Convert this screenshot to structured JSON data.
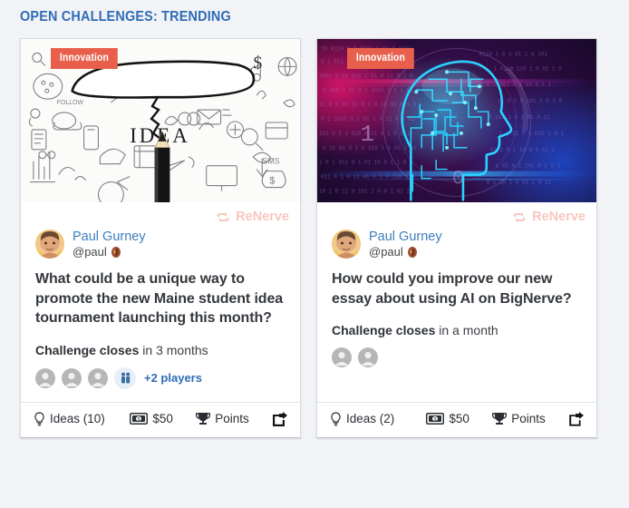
{
  "section": {
    "title": "OPEN CHALLENGES: TRENDING"
  },
  "colors": {
    "accent_blue": "#2f6cb5",
    "tag_red": "#e8604c",
    "renerve_pink": "#f7c7bf",
    "page_bg": "#f1f3f7",
    "card_bg": "#ffffff",
    "text_dark": "#34383d"
  },
  "cards": [
    {
      "tag": "Innovation",
      "hero_icon": "idea-doodle-pencil-image",
      "renerve_label": "ReNerve",
      "renerve_icon": "renerve-retweet-icon",
      "author": {
        "avatar_icon": "user-photo-avatar",
        "name": "Paul Gurney",
        "handle": "@paul",
        "badge_icon": "brain-emoji"
      },
      "title": "What could be a unique way to promote the new Maine student idea tournament launching this month?",
      "closes_label": "Challenge closes",
      "closes_value": "in 3 months",
      "player_avatars": 3,
      "more_players_icon": "two-people-icon",
      "more_players_label": "+2 players",
      "footer": {
        "ideas_icon": "lightbulb-icon",
        "ideas_label": "Ideas (10)",
        "money_icon": "money-bill-icon",
        "money_label": "$50",
        "points_icon": "trophy-icon",
        "points_label": "Points",
        "share_icon": "share-square-icon"
      }
    },
    {
      "tag": "Innovation",
      "hero_icon": "ai-brain-head-image",
      "renerve_label": "ReNerve",
      "renerve_icon": "renerve-retweet-icon",
      "author": {
        "avatar_icon": "user-photo-avatar",
        "name": "Paul Gurney",
        "handle": "@paul",
        "badge_icon": "brain-emoji"
      },
      "title": "How could you improve our new essay about using AI on BigNerve?",
      "closes_label": "Challenge closes",
      "closes_value": "in a month",
      "player_avatars": 2,
      "more_players_icon": null,
      "more_players_label": null,
      "footer": {
        "ideas_icon": "lightbulb-icon",
        "ideas_label": "Ideas (2)",
        "money_icon": "money-bill-icon",
        "money_label": "$50",
        "points_icon": "trophy-icon",
        "points_label": "Points",
        "share_icon": "share-square-icon"
      }
    }
  ]
}
